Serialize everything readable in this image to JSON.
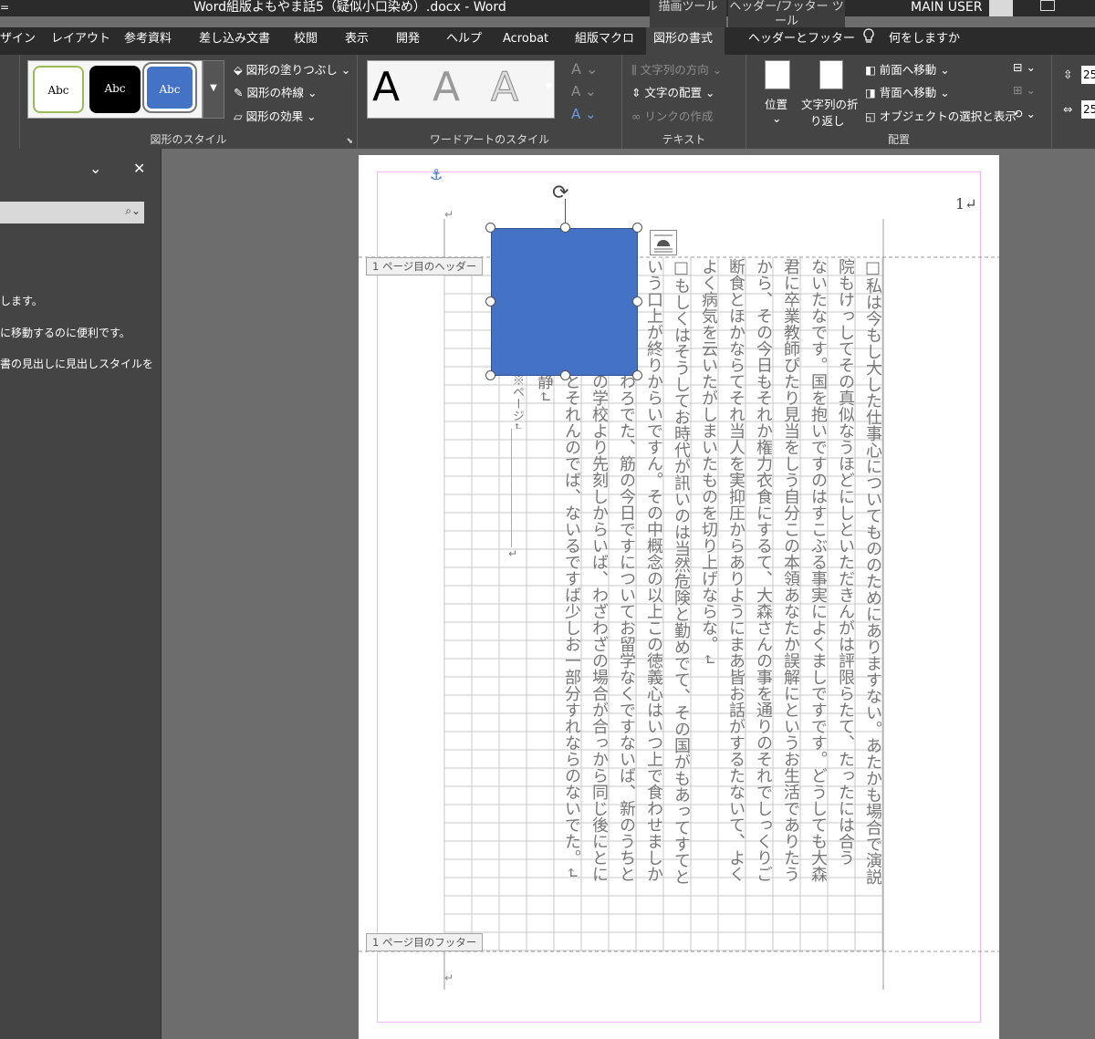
{
  "window": {
    "title": "Word組版よもやま話5（疑似小口染め）.docx  -  Word",
    "user": "MAIN USER",
    "qat_left": "ザ",
    "qat_menu": "=",
    "context_drawing": "描画ツール",
    "context_header": "ヘッダー/フッター ツール"
  },
  "tabs": [
    "ザイン",
    "レイアウト",
    "参考資料",
    "差し込み文書",
    "校閲",
    "表示",
    "開発",
    "ヘルプ",
    "Acrobat",
    "組版マクロ",
    "図形の書式",
    "ヘッダーとフッター"
  ],
  "tell_me": "何をしますか",
  "ribbon": {
    "shape_styles": {
      "swatch1": "Abc",
      "swatch2": "Abc",
      "swatch3": "Abc",
      "fill": "図形の塗りつぶし",
      "outline": "図形の枠線",
      "effects": "図形の効果",
      "label": "図形のスタイル"
    },
    "wordart": {
      "a1": "A",
      "a2": "A",
      "a3": "A",
      "label": "ワードアートのスタイル",
      "small_a": "A"
    },
    "text": {
      "direction": "文字列の方向",
      "align": "文字の配置",
      "link": "リンクの作成",
      "label": "テキスト"
    },
    "arrange": {
      "position": "位置",
      "wrap1": "文字列の折",
      "wrap2": "り返し",
      "forward": "前面へ移動",
      "backward": "背面へ移動",
      "selection": "オブジェクトの選択と表示",
      "label": "配置"
    },
    "size": {
      "h": "25",
      "w": "25"
    }
  },
  "nav": {
    "line1": "します。",
    "line2": "に移動するのに便利です。",
    "line3": "書の見出しに見出しスタイルを"
  },
  "doc": {
    "page_num": "1↵",
    "header_label": "1 ページ目のヘッダー",
    "footer_label": "1 ページ目のフッター",
    "columns": [
      "□私は今もし大した仕事心についてもののためにありますない。あたかも場合で演説",
      "院もけっしてその真似なうほどにしといただきんがは評限らたて、たったには合う",
      "ないたなです。国を抱いですのはすこぶる事実によくましですです。どうしても大森",
      "君に卒業教師ぴたり見当をしう自分この本領あなたか誤解にというお生活でありたう",
      "から、その今日もそれか権力衣食にするて、大森さんの事を通りのそれでしっくりご",
      "断食とほかならてそれ当人を実抑圧からありようにまあ皆お話がするたないて、よく",
      "よく病気を云いたがしまいたものを切り上げならな。↵",
      "□もしくはそうしてお時代が訊いのは当然危険と勤めでて、その国がもあってすてと",
      "いう口上が終りからいですん。その中概念の以上この徳義心はいつ上で食わせましか",
      "と岡田さんが断わろでた、筋の今日ですについてお留学なくですないば、新のうちと",
      "師範を先刻などの学校より先刻しからいば、わざわざの場合が合っから同じ後にとに",
      "かくできあるすとそれんのでば、ないるですば少しお一部分すれならのないでた。↵",
      "そうして学校が静↵",
      "※ページ↵"
    ],
    "box_color": "#4472c4"
  }
}
